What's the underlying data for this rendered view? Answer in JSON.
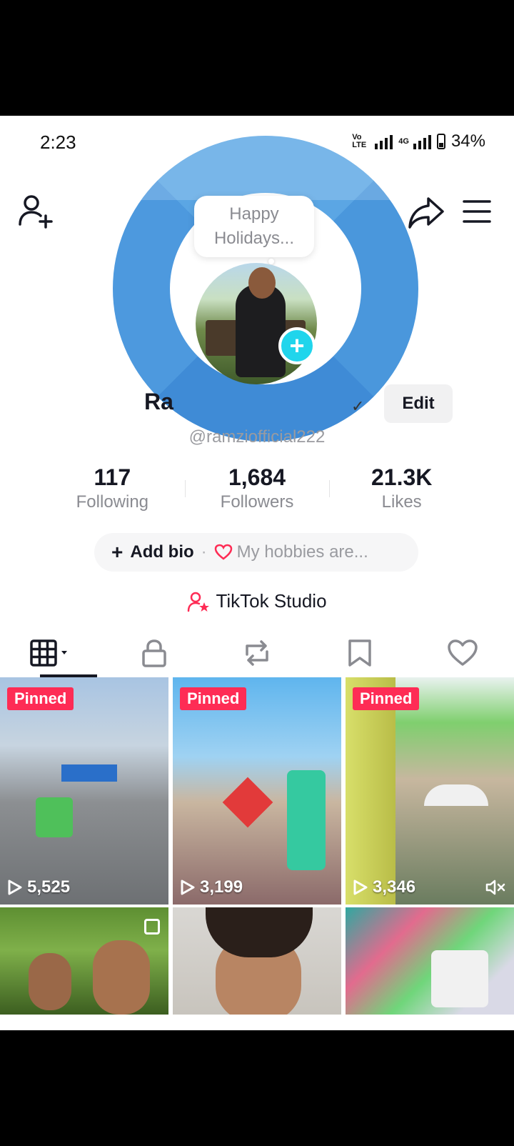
{
  "status_bar": {
    "time": "2:23",
    "volte": "VoB\nLTE8",
    "network": "4G",
    "battery": "34%"
  },
  "colors": {
    "accent_pink": "#fe2c55",
    "accent_cyan": "#20d5ec",
    "ring_blue": "#4a97dc",
    "text_primary": "#161823",
    "text_secondary": "#8a8b91"
  },
  "header": {
    "add_friend_icon": "add-user-icon",
    "share_icon": "share-arrow-icon",
    "menu_icon": "hamburger-menu-icon"
  },
  "profile": {
    "story_bubble": "Happy\nHolidays...",
    "name": "Ra",
    "edit_label": "Edit",
    "handle": "@ramziofficial222"
  },
  "stats": [
    {
      "value": "117",
      "label": "Following"
    },
    {
      "value": "1,684",
      "label": "Followers"
    },
    {
      "value": "21.3K",
      "label": "Likes"
    }
  ],
  "bio": {
    "add_label": "Add bio",
    "separator": "·",
    "hint": "My hobbies are..."
  },
  "studio": {
    "label": "TikTok Studio"
  },
  "tabs": [
    {
      "name": "videos-grid",
      "icon": "grid-icon"
    },
    {
      "name": "private",
      "icon": "lock-icon"
    },
    {
      "name": "reposts",
      "icon": "repost-icon"
    },
    {
      "name": "favorites",
      "icon": "bookmark-icon"
    },
    {
      "name": "liked",
      "icon": "heart-icon"
    }
  ],
  "videos": [
    {
      "pinned": "Pinned",
      "views": "5,525"
    },
    {
      "pinned": "Pinned",
      "views": "3,199"
    },
    {
      "pinned": "Pinned",
      "views": "3,346"
    }
  ]
}
